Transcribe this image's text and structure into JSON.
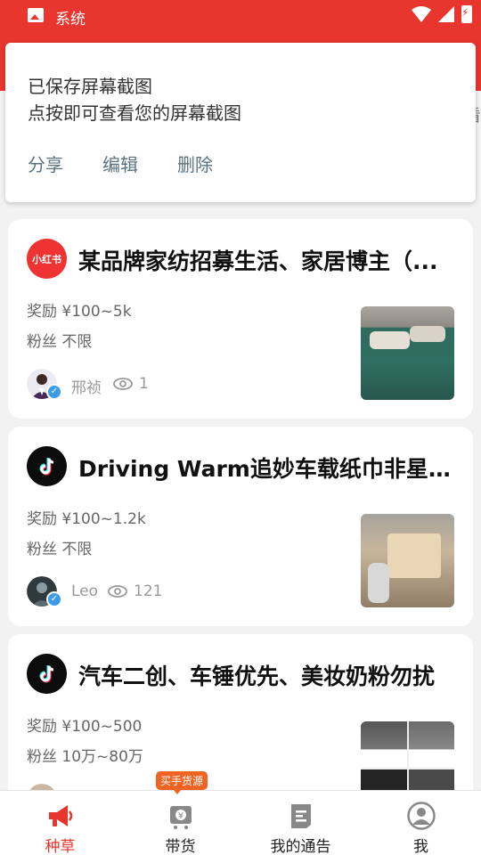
{
  "status_bar": {
    "title": "系统"
  },
  "toast": {
    "line1": "已保存屏幕截图",
    "line2": "点按即可查看您的屏幕截图",
    "actions": [
      "分享",
      "编辑",
      "删除"
    ]
  },
  "side_glyph": "看",
  "cards": [
    {
      "platform_icon": "xiaohongshu-logo",
      "platform_text": "小红书",
      "title": "某品牌家纺招募生活、家居博主（...",
      "reward": "奖励 ¥100~5k",
      "fans": "粉丝 不限",
      "author": "邢祯",
      "views": "1"
    },
    {
      "platform_icon": "tiktok-logo",
      "title": "Driving Warm追妙车载纸巾非星图...",
      "reward": "奖励 ¥100~1.2k",
      "fans": "粉丝 不限",
      "author": "Leo",
      "views": "121"
    },
    {
      "platform_icon": "tiktok-logo",
      "title": "汽车二创、车锤优先、美妆奶粉勿扰",
      "reward": "奖励 ¥100~500",
      "fans": "粉丝 10万~80万",
      "author": "",
      "views": ""
    }
  ],
  "tabbar": {
    "badge": "买手货源",
    "tabs": [
      {
        "label": "种草",
        "icon": "megaphone-icon",
        "active": true
      },
      {
        "label": "带货",
        "icon": "cart-icon",
        "active": false
      },
      {
        "label": "我的通告",
        "icon": "document-icon",
        "active": false
      },
      {
        "label": "我",
        "icon": "user-icon",
        "active": false
      }
    ]
  },
  "colors": {
    "accent": "#e8352e",
    "action_text": "#5a7280",
    "verified": "#3a9be8",
    "badge": "#f06423"
  }
}
